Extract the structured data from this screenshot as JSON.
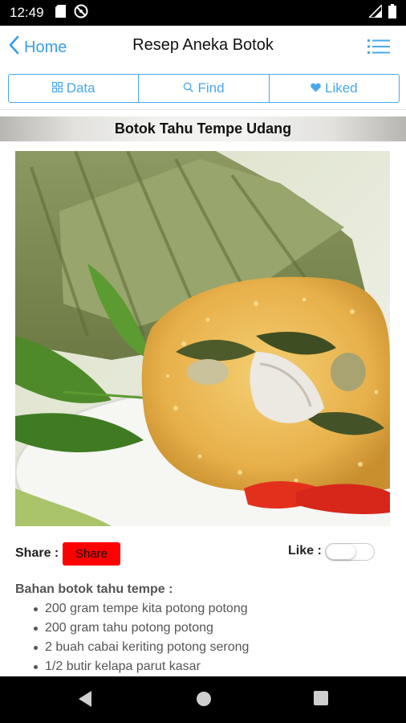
{
  "status_bar": {
    "time": "12:49",
    "left_icons": [
      "sd-card-icon",
      "do-not-disturb-icon"
    ],
    "right_icons": [
      "signal-icon",
      "battery-icon"
    ]
  },
  "header": {
    "back_label": "Home",
    "title": "Resep Aneka Botok",
    "menu_icon": "list-menu-icon"
  },
  "tabs": [
    {
      "label": "Data",
      "icon": "grid-icon"
    },
    {
      "label": "Find",
      "icon": "search-icon"
    },
    {
      "label": "Liked",
      "icon": "heart-icon"
    }
  ],
  "recipe": {
    "title": "Botok Tahu Tempe Udang",
    "share_label": "Share :",
    "share_button": "Share",
    "like_label": "Like :",
    "liked": false,
    "ingredients_heading": "Bahan botok tahu tempe :",
    "ingredients": [
      "200 gram tempe kita potong potong",
      "200 gram tahu potong potong",
      "2 buah cabai keriting potong serong",
      "1/2 butir kelapa parut kasar"
    ]
  },
  "colors": {
    "accent": "#4aa8e8",
    "share_button": "#ff0000"
  },
  "nav_bar": {
    "icons": [
      "back-triangle-icon",
      "home-circle-icon",
      "recents-square-icon"
    ]
  }
}
